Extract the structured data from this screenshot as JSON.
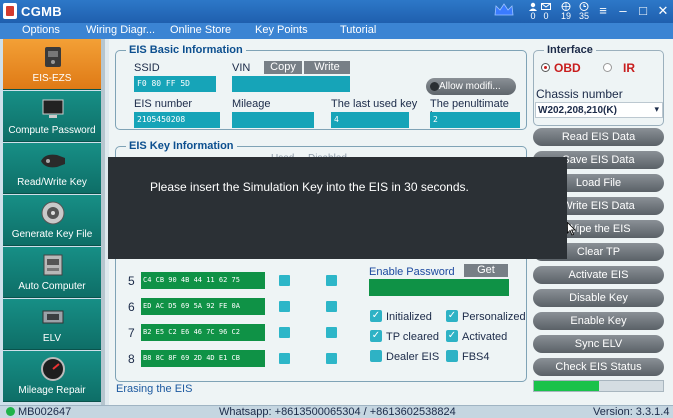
{
  "window": {
    "title": "CGMB",
    "stats": [
      {
        "icon": "crown-icon",
        "value": ""
      },
      {
        "icon": "user-icon",
        "value": "0"
      },
      {
        "icon": "mail-icon",
        "value": "0"
      },
      {
        "icon": "globe-icon",
        "value": "19"
      },
      {
        "icon": "clock-icon",
        "value": "35"
      }
    ],
    "controls": {
      "minimize": "–",
      "maximize": "□",
      "close": "✕"
    }
  },
  "menu": [
    "Options",
    "Wiring Diagr...",
    "Online Store",
    "Key Points",
    "Tutorial"
  ],
  "sidebar": {
    "items": [
      {
        "label": "EIS-EZS",
        "icon": "eis-icon",
        "active": true
      },
      {
        "label": "Compute Password",
        "icon": "computer-icon",
        "active": false
      },
      {
        "label": "Read/Write Key",
        "icon": "car-key-icon",
        "active": false
      },
      {
        "label": "Generate Key File",
        "icon": "disc-icon",
        "active": false
      },
      {
        "label": "Auto Computer",
        "icon": "ecu-icon",
        "active": false
      },
      {
        "label": "ELV",
        "icon": "elv-icon",
        "active": false
      },
      {
        "label": "Mileage Repair",
        "icon": "gauge-icon",
        "active": false
      }
    ]
  },
  "basic_info": {
    "title": "EIS Basic Information",
    "ssid_label": "SSID",
    "ssid_value": "F0 80 FF 5D",
    "vin_label": "VIN",
    "copy_label": "Copy",
    "write_label": "Write",
    "vin_value": "",
    "allow_label": "Allow modifi...",
    "eis_number_label": "EIS number",
    "eis_number_value": "2105450208",
    "mileage_label": "Mileage",
    "mileage_value": "",
    "last_key_label": "The last used key",
    "last_key_value": "4",
    "penultimate_label": "The penultimate key",
    "penultimate_value": "2"
  },
  "key_info": {
    "title": "EIS Key Information",
    "header_used": "Used",
    "header_disabled": "Disabled",
    "keys": [
      {
        "num": "5",
        "data": "C4 CB 90 4B 44 11 62 75"
      },
      {
        "num": "6",
        "data": "ED AC D5 69 5A 92 FE 0A"
      },
      {
        "num": "7",
        "data": "B2 E5 C2 E6 46 7C 96 C2"
      },
      {
        "num": "8",
        "data": "B8 8C 8F 69 2D 4D E1 CB"
      }
    ],
    "enable_password_label": "Enable Password",
    "get_label": "Get",
    "enable_password_value": "",
    "flags": [
      {
        "label": "Initialized",
        "checked": true
      },
      {
        "label": "Personalized",
        "checked": true
      },
      {
        "label": "TP cleared",
        "checked": true
      },
      {
        "label": "Activated",
        "checked": true
      },
      {
        "label": "Dealer EIS",
        "checked": false
      },
      {
        "label": "FBS4",
        "checked": false
      }
    ],
    "erasing_text": "Erasing  the  EIS"
  },
  "interface": {
    "title": "Interface",
    "options": [
      "OBD",
      "IR"
    ],
    "selected": "OBD",
    "chassis_label": "Chassis number",
    "chassis_value": "W202,208,210(K)"
  },
  "actions": [
    "Read EIS Data",
    "Save EIS Data",
    "Load File",
    "Write EIS Data",
    "Wipe the EIS",
    "Clear TP",
    "Activate EIS",
    "Disable Key",
    "Enable Key",
    "Sync ELV",
    "Check EIS Status"
  ],
  "progress": {
    "fraction": 0.5
  },
  "status": {
    "device_id": "MB002647",
    "contact": "Whatsapp: +8613500065304 / +8613602538824",
    "version": "Version: 3.3.1.4"
  },
  "dialog": {
    "message": "Please  insert  the  Simulation  Key  into  the  EIS  in  30  seconds."
  },
  "colors": {
    "titlebar": "#2d78c8",
    "sidebar_item": "#178f86",
    "sidebar_active": "#f3a036",
    "field": "#16a4b8",
    "key_field": "#0f9246",
    "progress": "#19c24a"
  }
}
